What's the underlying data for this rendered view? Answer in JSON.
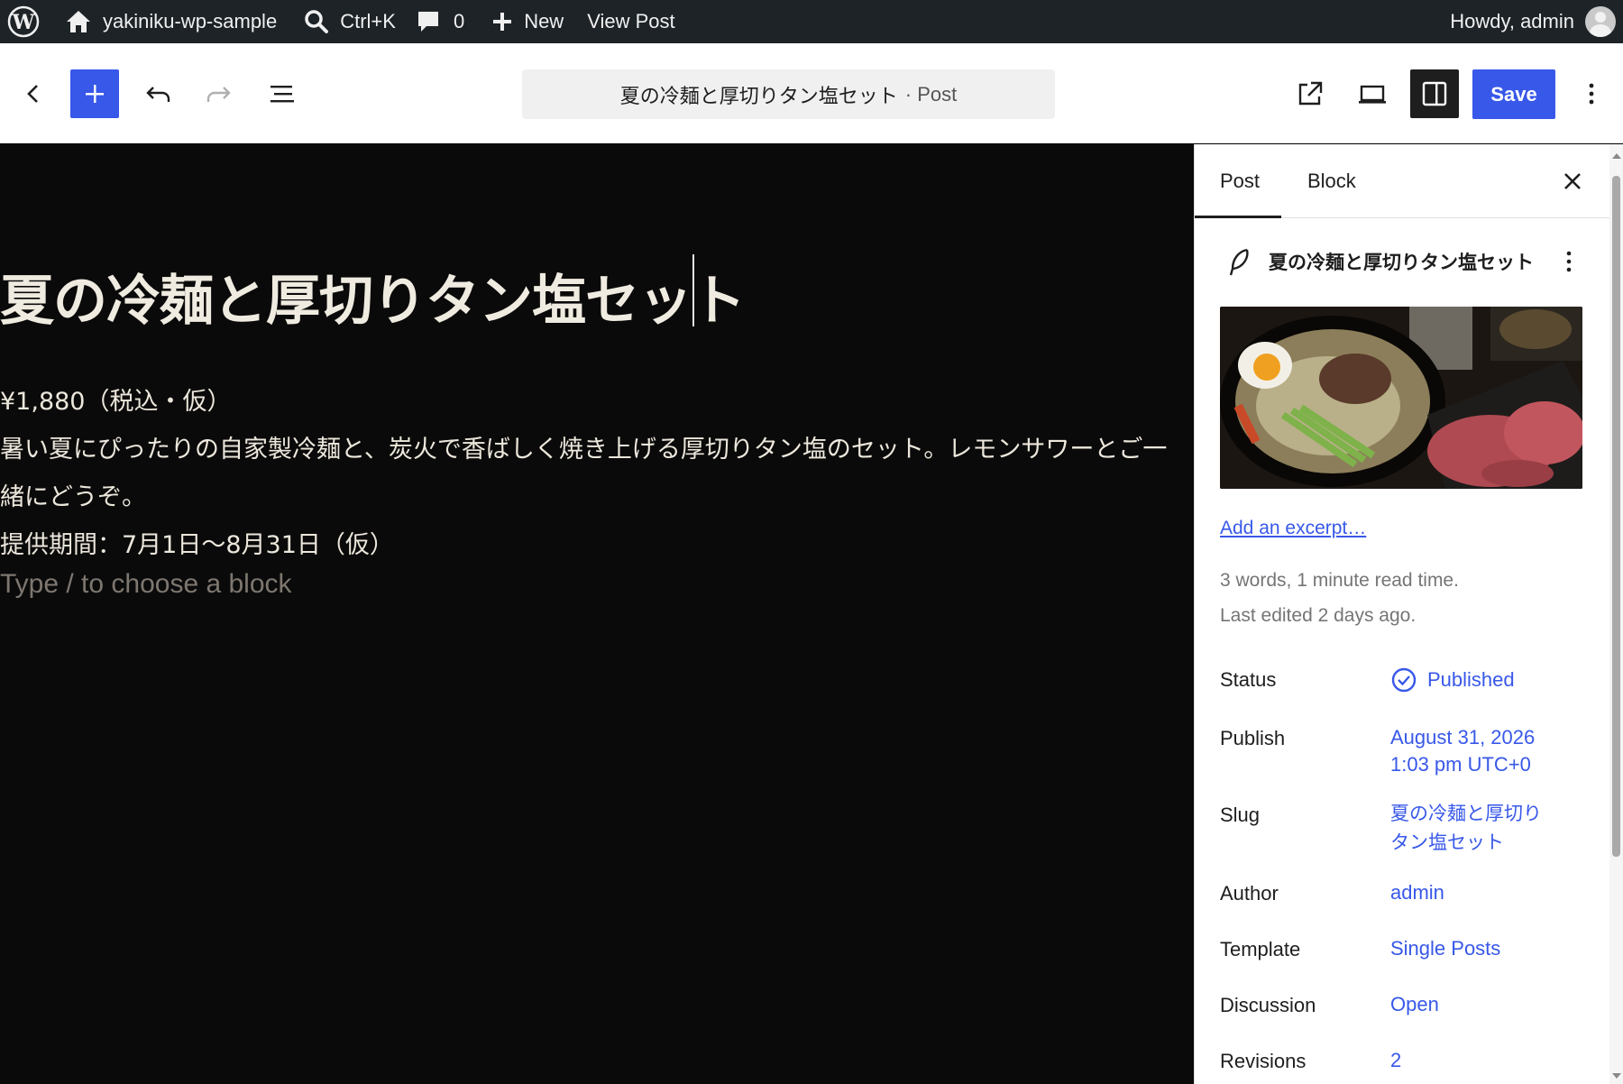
{
  "admin_bar": {
    "site_name": "yakiniku-wp-sample",
    "search_shortcut": "Ctrl+K",
    "comments_count": "0",
    "new_label": "New",
    "view_post_label": "View Post",
    "howdy": "Howdy, admin"
  },
  "header": {
    "document_title": "夏の冷麺と厚切りタン塩セット",
    "document_type": "· Post",
    "save_label": "Save"
  },
  "canvas": {
    "title": "夏の冷麺と厚切りタン塩セット",
    "price": "¥1,880（税込・仮）",
    "description_line1": "暑い夏にぴったりの自家製冷麺と、炭火で香ばしく焼き上げる厚切りタン塩のセット。レモンサワーとご一",
    "description_line2": "緒にどうぞ。",
    "period": "提供期間：7月1日〜8月31日（仮）",
    "placeholder": "Type / to choose a block"
  },
  "sidebar": {
    "tabs": [
      {
        "label": "Post",
        "active": true
      },
      {
        "label": "Block",
        "active": false
      }
    ],
    "post_title": "夏の冷麺と厚切りタン塩セット",
    "excerpt_link": "Add an excerpt…",
    "word_count": "3 words, 1 minute read time.",
    "last_edited": "Last edited 2 days ago.",
    "rows": {
      "status": {
        "label": "Status",
        "value": "Published"
      },
      "publish": {
        "label": "Publish",
        "value_line1": "August 31, 2026",
        "value_line2": "1:03 pm UTC+0"
      },
      "slug": {
        "label": "Slug",
        "value_line1": "夏の冷麺と厚切り",
        "value_line2": "タン塩セット"
      },
      "author": {
        "label": "Author",
        "value": "admin"
      },
      "template": {
        "label": "Template",
        "value": "Single Posts"
      },
      "discussion": {
        "label": "Discussion",
        "value": "Open"
      },
      "revisions": {
        "label": "Revisions",
        "value": "2"
      }
    }
  },
  "colors": {
    "accent": "#3858e9",
    "admin_bar": "#1d2327",
    "canvas_bg": "#0b0a0a"
  }
}
